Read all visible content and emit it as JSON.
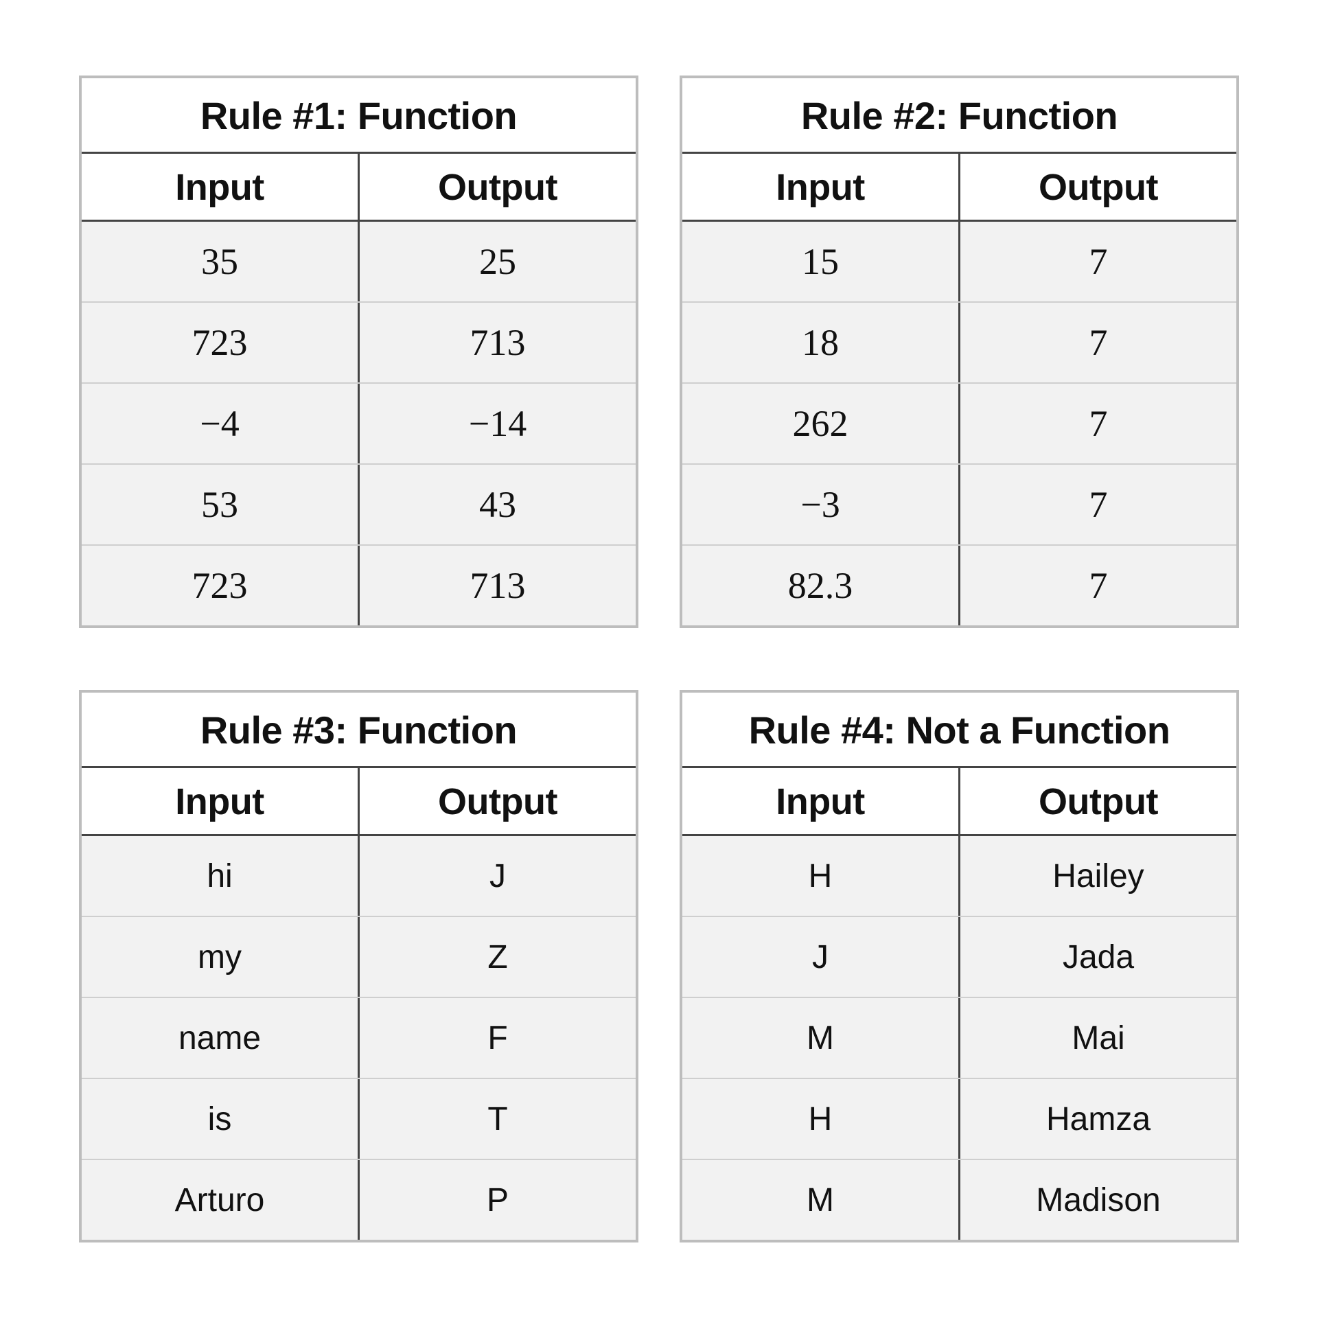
{
  "chart_data": [
    {
      "type": "table",
      "title": "Rule #1: Function",
      "columns": [
        "Input",
        "Output"
      ],
      "rows": [
        [
          "35",
          "25"
        ],
        [
          "723",
          "713"
        ],
        [
          "−4",
          "−14"
        ],
        [
          "53",
          "43"
        ],
        [
          "723",
          "713"
        ]
      ],
      "cell_style": "mathnum"
    },
    {
      "type": "table",
      "title": "Rule #2: Function",
      "columns": [
        "Input",
        "Output"
      ],
      "rows": [
        [
          "15",
          "7"
        ],
        [
          "18",
          "7"
        ],
        [
          "262",
          "7"
        ],
        [
          "−3",
          "7"
        ],
        [
          "82.3",
          "7"
        ]
      ],
      "cell_style": "mathnum"
    },
    {
      "type": "table",
      "title": "Rule #3: Function",
      "columns": [
        "Input",
        "Output"
      ],
      "rows": [
        [
          "hi",
          "J"
        ],
        [
          "my",
          "Z"
        ],
        [
          "name",
          "F"
        ],
        [
          "is",
          "T"
        ],
        [
          "Arturo",
          "P"
        ]
      ],
      "cell_style": "sans"
    },
    {
      "type": "table",
      "title": "Rule #4: Not a Function",
      "columns": [
        "Input",
        "Output"
      ],
      "rows": [
        [
          "H",
          "Hailey"
        ],
        [
          "J",
          "Jada"
        ],
        [
          "M",
          "Mai"
        ],
        [
          "H",
          "Hamza"
        ],
        [
          "M",
          "Madison"
        ]
      ],
      "cell_style": "sans"
    }
  ]
}
